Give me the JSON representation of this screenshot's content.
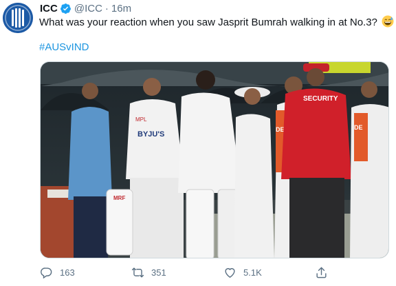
{
  "tweet": {
    "author_name": "ICC",
    "handle": "@ICC",
    "separator": "·",
    "time": "16m",
    "text": "What was your reaction when you saw Jasprit Bumrah walking in at No.3?",
    "hashtag": "#AUSvIND",
    "media": {
      "banner_byjus": "BYJU'S",
      "banner_mpl": "MPL",
      "security_label": "SECURITY",
      "shirt_label_center": "DE",
      "shirt_label_right": "DE",
      "pad_brand": "MRF"
    },
    "actions": {
      "replies": "163",
      "retweets": "351",
      "likes": "5.1K"
    }
  },
  "colors": {
    "link": "#1b95e0",
    "secondary_text": "#5b7083",
    "verified": "#1da1f2",
    "security_jacket": "#d0202a"
  }
}
